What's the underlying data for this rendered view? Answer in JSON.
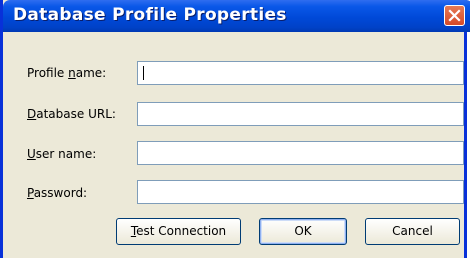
{
  "window": {
    "title": "Database Profile Properties",
    "close_icon": "close-icon"
  },
  "form": {
    "profile_name": {
      "label_pre": "Profile ",
      "label_mn": "n",
      "label_post": "ame:",
      "value": ""
    },
    "database_url": {
      "label_pre": "",
      "label_mn": "D",
      "label_post": "atabase URL:",
      "value": ""
    },
    "user_name": {
      "label_pre": "",
      "label_mn": "U",
      "label_post": "ser name:",
      "value": ""
    },
    "password": {
      "label_pre": "",
      "label_mn": "P",
      "label_post": "assword:",
      "value": ""
    }
  },
  "buttons": {
    "test_connection": {
      "mn": "T",
      "rest": "est Connection"
    },
    "ok": "OK",
    "cancel": "Cancel"
  },
  "colors": {
    "titlebar": "#0049d8",
    "dialog_bg": "#ece9d8",
    "close_bg": "#d54a28",
    "field_border": "#7f9db9"
  }
}
